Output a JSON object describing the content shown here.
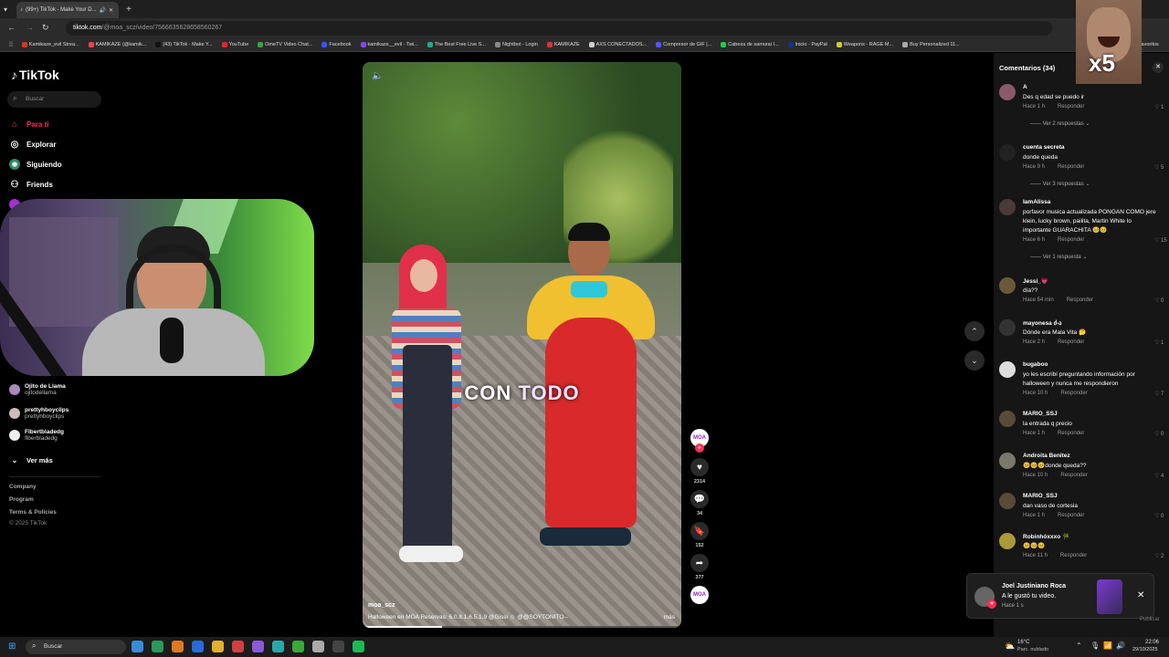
{
  "browser": {
    "tab_title": "(99+) TikTok - Make Your D...",
    "url_host": "tiktok.com",
    "url_path": "/@moa_scz/video/7566635628658560267",
    "bookmarks": [
      "Kamikaze_evil Strea...",
      "KAMIKAZE (@kamik...",
      "(43) TikTok - Make Y...",
      "YouTube",
      "OmeTV Video Chat...",
      "Facebook",
      "kamikaze__evil - Twi...",
      "The Best Free Live S...",
      "Nightbot - Login",
      "KAMIKAZE",
      "AXS CONECTADOS...",
      "Compresor de GIF |...",
      "Cabeza de samurai I...",
      "Inicio - PayPal",
      "Weapons - RAGE M...",
      "Buy Personalized 11..."
    ],
    "bookmark_colors": [
      "#d32",
      "#e44",
      "#111",
      "#e22",
      "#3a3",
      "#35f",
      "#84f",
      "#2a8",
      "#888",
      "#d33",
      "#ccc",
      "#55f",
      "#2c4",
      "#138",
      "#cc3",
      "#aaa"
    ],
    "favorites": "favoritos"
  },
  "sidebar": {
    "logo": "TikTok",
    "search_placeholder": "Buscar",
    "nav": [
      {
        "label": "Para ti",
        "icon": "home-icon",
        "active": true
      },
      {
        "label": "Explorar",
        "icon": "compass-icon",
        "active": false
      },
      {
        "label": "Siguiendo",
        "icon": "following-icon",
        "active": false
      },
      {
        "label": "Friends",
        "icon": "friends-icon",
        "active": false
      }
    ],
    "following": [
      {
        "name": "Ojito de Llama",
        "handle": "ojitodellama"
      },
      {
        "name": "prettyhboyclips",
        "handle": "prettyhboyclips"
      },
      {
        "name": "Flbertbladedg",
        "handle": "flberbladedg"
      }
    ],
    "see_more": "Ver más",
    "footer": [
      "Company",
      "Program",
      "Terms & Policies",
      "© 2025 TikTok"
    ]
  },
  "video": {
    "caption_word1": "CON",
    "caption_word2": "TODO",
    "author": "moa_scz",
    "description": "Halloween en MOA Reservas: 6.0.8.1.6.5.1.9 @Gissi ☺ @@SOYTOÑITO--",
    "more": "más",
    "likes": "2314",
    "comments": "34",
    "saves": "152",
    "shares": "377"
  },
  "comments_panel": {
    "title": "Comentarios (34)",
    "reply_label": "Responder",
    "items": [
      {
        "user": "A",
        "text": "Des q edad se puedo ir",
        "time": "Hace 1 h",
        "likes": "1",
        "replies": "Ver 2 respuestas",
        "avatar": "#8a5a6a"
      },
      {
        "user": "cuenta secreta",
        "text": "donde queda",
        "time": "Hace 9 h",
        "likes": "5",
        "replies": "Ver 3 respuestas",
        "avatar": "#222"
      },
      {
        "user": "IamAlissa",
        "text": "porfavor musica actualizada PONGAN COMO jere klein, lucky brown, pailita, Martin White lo importante GUARACHITA 🥺🥺",
        "time": "Hace 6 h",
        "likes": "15",
        "replies": "Ver 1 respuesta",
        "avatar": "#4a3a3a"
      },
      {
        "user": "Jessi_💗",
        "text": "día??",
        "time": "Hace 54 min",
        "likes": "0",
        "replies": "",
        "avatar": "#6a5a3a"
      },
      {
        "user": "mayonesa ძ-ა",
        "text": "Dónde era Mala Vita 🤔",
        "time": "Hace 2 h",
        "likes": "1",
        "replies": "",
        "avatar": "#333"
      },
      {
        "user": "bugaboo",
        "text": "yo les escribí preguntando información por halloween y nunca me respondieron",
        "time": "Hace 10 h",
        "likes": "7",
        "replies": "",
        "avatar": "#ddd"
      },
      {
        "user": "MARIO_SSJ",
        "text": "la entrada q precio",
        "time": "Hace 1 h",
        "likes": "0",
        "replies": "",
        "avatar": "#5a4a3a"
      },
      {
        "user": "Androita Benitez",
        "text": "🥺🥺🥺donde queda??",
        "time": "Hace 10 h",
        "likes": "4",
        "replies": "",
        "avatar": "#7a7a6a"
      },
      {
        "user": "MARIO_SSJ",
        "text": "dan vaso de cortesia",
        "time": "Hace 1 h",
        "likes": "0",
        "replies": "",
        "avatar": "#5a4a3a"
      },
      {
        "user": "Robinhóxxxo 🎋",
        "text": "🥺🥺🥺",
        "time": "Hace 11 h",
        "likes": "2",
        "replies": "",
        "avatar": "#aa9a3a"
      }
    ]
  },
  "notification": {
    "name": "Joel Justiniano Roca",
    "text": "A le gustó tu video.",
    "time": "Hace 1 s",
    "post": "Publicar"
  },
  "meme_overlay": "x5",
  "taskbar": {
    "search": "Buscar",
    "weather_temp": "16°C",
    "weather_desc": "Parc. nublado",
    "time": "22:06",
    "date": "29/10/2025"
  }
}
